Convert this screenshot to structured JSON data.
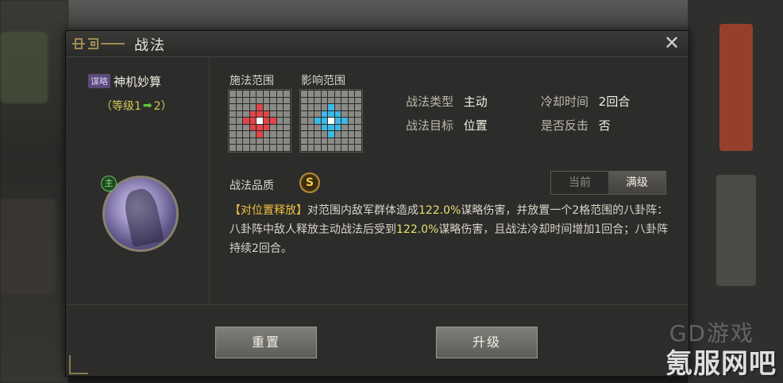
{
  "window": {
    "title": "战法",
    "close_icon": "close-icon"
  },
  "skill": {
    "type_badge": "谋略",
    "name": "神机妙算",
    "level_prefix": "（等级1",
    "level_suffix": "2）",
    "main_badge": "主"
  },
  "ranges": {
    "cast_label": "施法范围",
    "effect_label": "影响范围"
  },
  "attributes": {
    "type_label": "战法类型",
    "type_value": "主动",
    "cooldown_label": "冷却时间",
    "cooldown_value": "2回合",
    "target_label": "战法目标",
    "target_value": "位置",
    "counter_label": "是否反击",
    "counter_value": "否"
  },
  "quality": {
    "label": "战法品质",
    "grade": "S"
  },
  "toggle": {
    "current": "当前",
    "max": "满级",
    "selected": "满级"
  },
  "description": {
    "tag": "【对位置释放】",
    "part1": "对范围内敌军群体造成",
    "pct1": "122.0%",
    "part2": "谋略伤害，并放置一个2格范围的八卦阵：八卦阵中敌人释放主动战法后受到",
    "pct2": "122.0%",
    "part3": "谋略伤害，且战法冷却时间增加1回合；八卦阵持续2回合。"
  },
  "buttons": {
    "reset": "重置",
    "upgrade": "升级"
  },
  "watermarks": {
    "small": "GD游戏",
    "large": "氪服网吧"
  },
  "colors": {
    "cast": "#e0454a",
    "effect": "#3cb8e6",
    "highlight": "#f0c040"
  }
}
